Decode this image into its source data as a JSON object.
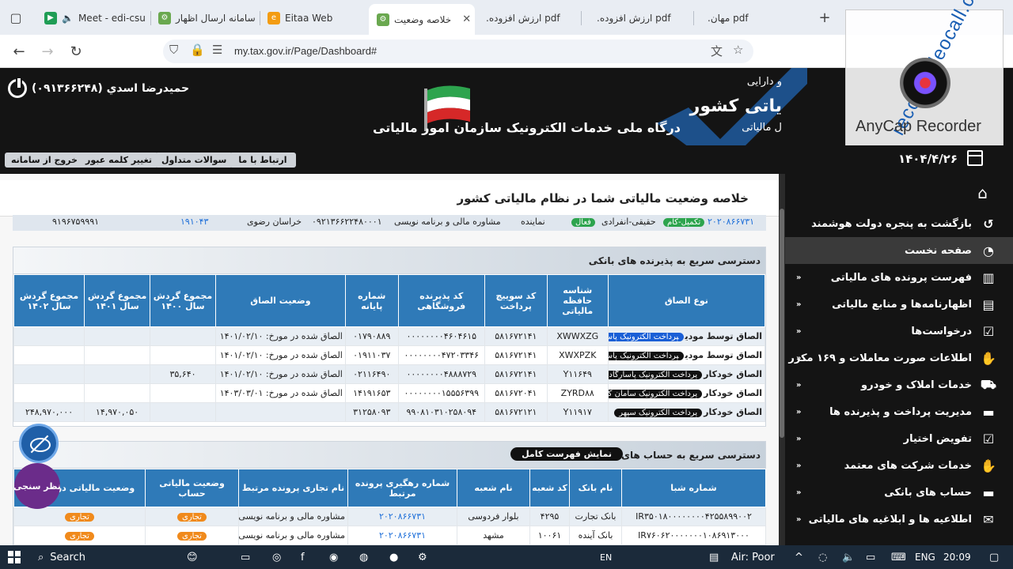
{
  "browser": {
    "tabs": [
      {
        "label": "Meet - edi-csu",
        "active": false
      },
      {
        "label": "سامانه ارسال اظهار",
        "active": false
      },
      {
        "label": "Eitaa Web",
        "active": false
      },
      {
        "label": "خلاصه وضعیت",
        "active": true
      },
      {
        "label": ".ارزش افزوده pdf",
        "active": false
      },
      {
        "label": ".ارزش افزوده pdf",
        "active": false
      },
      {
        "label": ".مهان pdf",
        "active": false
      }
    ],
    "url": "my.tax.gov.ir/Page/Dashboard#"
  },
  "header": {
    "user": "حمیدرضا اسدي (۰۹۱۳۶۶۲۴۸)",
    "portal_title": "درگاه ملی خدمات الکترونیک سازمان امور مالیاتی",
    "brand_top": "و دارایی",
    "brand_main": "یاتی کشور",
    "brand_sub": "ل مالیاتی"
  },
  "watermark": {
    "name": "AnyCap Recorder",
    "url": "recordvideocall.com"
  },
  "actions": {
    "contact": "ارتباط با ما",
    "faq": "سوالات متداول",
    "change_password": "تغییر کلمه عبور",
    "logout": "خروج از سامانه"
  },
  "date": "۱۴۰۴/۴/۲۶",
  "sidebar": {
    "items": [
      {
        "label": "بازگشت به پنجره دولت هوشمند",
        "icon": "undo-icon",
        "arrow": false,
        "active": false
      },
      {
        "label": "صفحه نخست",
        "icon": "dashboard-icon",
        "arrow": false,
        "active": true
      },
      {
        "label": "فهرست پرونده های مالیاتی",
        "icon": "books-icon",
        "arrow": true,
        "active": false
      },
      {
        "label": "اظهارنامه‌ها و منابع مالیاتی",
        "icon": "file-icon",
        "arrow": true,
        "active": false
      },
      {
        "label": "درخواست‌ها",
        "icon": "request-icon",
        "arrow": true,
        "active": false
      },
      {
        "label": "اطلاعات صورت معاملات و ۱۶۹ مکرر",
        "icon": "handshake-icon",
        "arrow": true,
        "active": false
      },
      {
        "label": "خدمات املاک و خودرو",
        "icon": "car-icon",
        "arrow": true,
        "active": false
      },
      {
        "label": "مدیریت پرداخت و پذیرنده ها",
        "icon": "card-icon",
        "arrow": true,
        "active": false
      },
      {
        "label": "تفویض اختیار",
        "icon": "delegate-icon",
        "arrow": true,
        "active": false
      },
      {
        "label": "خدمات شرکت های معتمد",
        "icon": "handshake-icon",
        "arrow": true,
        "active": false
      },
      {
        "label": "حساب های بانکی",
        "icon": "card-icon",
        "arrow": true,
        "active": false
      },
      {
        "label": "اطلاعیه ها و ابلاغیه های مالیاتی",
        "icon": "mail-icon",
        "arrow": true,
        "active": false
      }
    ]
  },
  "main": {
    "title": "خلاصه وضعیت مالیاتی شما در نظام مالیاتی کشور",
    "info": {
      "file_no": "۲۰۲۰۸۶۶۷۳۱",
      "file_status": "تکمیل-کام",
      "type": "حقیقی-انفرادی",
      "type_badge": "فعال",
      "role": "نماینده",
      "activity": "مشاوره مالی و برنامه نویسی",
      "mobile": "۰۹۲۱۳۶۶۲۲۴۸۰۰۰۱",
      "province": "خراسان رضوی",
      "code": "۱۹۱۰۴۳",
      "postal": "۹۱۹۶۷۵۹۹۹۱"
    },
    "pos_panel": {
      "title": "دسترسی سریع به پذیرنده های بانکی",
      "headers": [
        "نوع الصاق",
        "شناسه حافظه مالیاتی",
        "کد سوییچ پرداخت",
        "کد پذیرنده فروشگاهی",
        "شماره پایانه",
        "وضعیت الصاق",
        "مجموع گردش سال ۱۴۰۰",
        "مجموع گردش سال ۱۴۰۱",
        "مجموع گردش سال ۱۴۰۲"
      ],
      "rows": [
        {
          "type": "الصاق توسط مودی",
          "provider": "پرداخت الکترونیک پاسارگاد",
          "selected": true,
          "memory": "XWWXZG",
          "switch": "۵۸۱۶۷۲۱۴۱",
          "merchant": "۰۰۰۰۰۰۰۰۴۶۰۴۶۱۵",
          "terminal": "۰۱۷۹۰۸۸۹",
          "status": "الصاق شده در مورخ: ۱۴۰۱/۰۲/۱۰",
          "y1400": "",
          "y1401": "",
          "y1402": ""
        },
        {
          "type": "الصاق توسط مودی",
          "provider": "پرداخت الکترونیک پاسارگاد",
          "selected": false,
          "memory": "XWXPZK",
          "switch": "۵۸۱۶۷۲۱۴۱",
          "merchant": "۰۰۰۰۰۰۰۰۴۷۲۰۳۳۴۶",
          "terminal": "۰۱۹۱۱۰۳۷",
          "status": "الصاق شده در مورخ: ۱۴۰۱/۰۲/۱۰",
          "y1400": "",
          "y1401": "",
          "y1402": ""
        },
        {
          "type": "الصاق خودکار",
          "provider": "پرداخت الکترونیک پاسارگاد",
          "selected": false,
          "memory": "Y۱۱۶۴۹",
          "switch": "۵۸۱۶۷۲۱۴۱",
          "merchant": "۰۰۰۰۰۰۰۰۴۸۸۸۷۲۹",
          "terminal": "۰۲۱۱۶۴۹۰",
          "status": "الصاق شده در مورخ: ۱۴۰۱/۰۲/۱۰",
          "y1400": "۳۵,۶۴۰",
          "y1401": "",
          "y1402": ""
        },
        {
          "type": "الصاق خودکار",
          "provider": "پرداخت الکترونیک سامان کیش",
          "selected": false,
          "memory": "ZYRD۸۸",
          "switch": "۵۸۱۶۷۲۰۴۱",
          "merchant": "۰۰۰۰۰۰۰۰۱۵۵۵۶۳۹۹",
          "terminal": "۱۴۱۹۱۶۵۳",
          "status": "الصاق شده در مورخ: ۱۴۰۳/۰۳/۰۱",
          "y1400": "",
          "y1401": "",
          "y1402": ""
        },
        {
          "type": "الصاق خودکار",
          "provider": "پرداخت الکترونیک سپهر",
          "selected": false,
          "memory": "Y۱۱۹۱۷",
          "switch": "۵۸۱۶۷۲۱۲۱",
          "merchant": "۹۹۰۸۱۰۳۱۰۲۵۸۰۹۴",
          "terminal": "۳۱۲۵۸۰۹۳",
          "status": "",
          "y1400": "",
          "y1401": "۱۴,۹۷۰,۰۵۰",
          "y1402": "۲۴۸,۹۷۰,۰۰۰"
        }
      ]
    },
    "bank_panel": {
      "title": "دسترسی سریع به حساب های بانکی",
      "show_all": "نمایش فهرست کامل",
      "headers": [
        "شماره شبا",
        "نام بانک",
        "کد شعبه",
        "نام شعبه",
        "شماره رهگیری پرونده مرتبط",
        "نام تجاری پرونده مرتبط",
        "وضعیت مالیاتی حساب",
        "وضعیت مالیاتی درخواست"
      ],
      "rows": [
        {
          "iban": "IR۳۵۰۱۸۰۰۰۰۰۰۰۰۴۲۵۵۸۹۹۰۰۲",
          "bank": "بانک تجارت",
          "branch_code": "۴۲۹۵",
          "branch": "بلوار فردوسی",
          "tracking": "۲۰۲۰۸۶۶۷۳۱",
          "trade": "مشاوره مالی و برنامه نویسی",
          "acc_status": "تجاری",
          "req_status": "تجاری"
        },
        {
          "iban": "IR۷۶۰۶۲۰۰۰۰۰۰۰۱۰۸۶۹۱۳۰۰۰",
          "bank": "بانک آینده",
          "branch_code": "۱۰۰۶۱",
          "branch": "مشهد",
          "tracking": "۲۰۲۰۸۶۶۷۳۱",
          "trade": "مشاوره مالی و برنامه نویسی",
          "acc_status": "تجاری",
          "req_status": "تجاری"
        }
      ]
    },
    "survey": "نظر سنجی"
  },
  "taskbar": {
    "search": "Search",
    "lang": "EN",
    "weather": "Air: Poor",
    "ime": "ENG",
    "time": "20:09"
  }
}
